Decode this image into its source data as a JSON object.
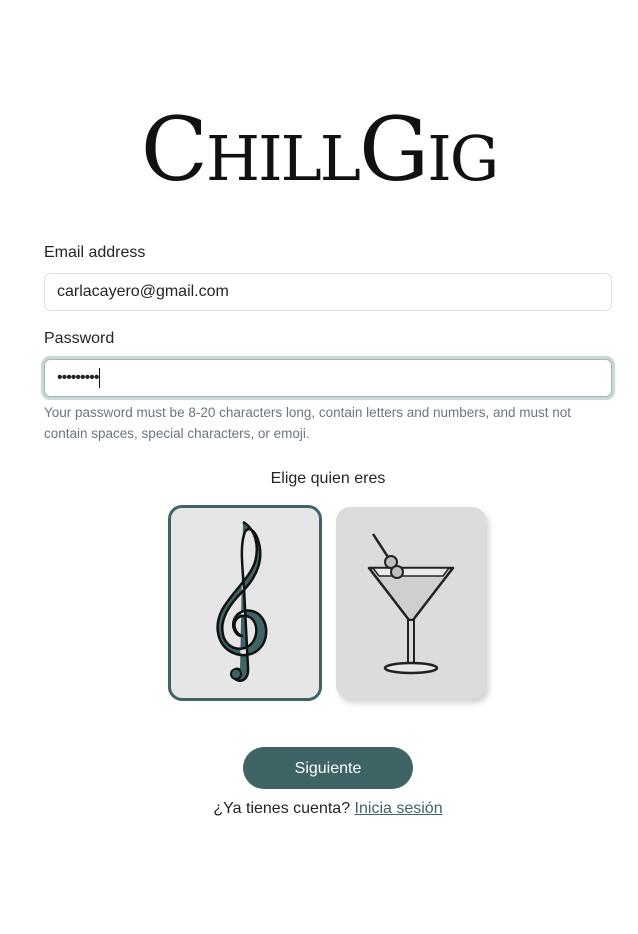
{
  "brand": {
    "logo_text": "ChillGig"
  },
  "form": {
    "email_label": "Email address",
    "email_value": "carlacayero@gmail.com",
    "password_label": "Password",
    "password_value": "•••••••••",
    "password_help": "Your password must be 8-20 characters long, contain letters and numbers, and must not contain spaces, special characters, or emoji."
  },
  "role_picker": {
    "title": "Elige quien eres",
    "options": [
      {
        "icon": "treble-clef-icon",
        "selected": true
      },
      {
        "icon": "martini-glass-icon",
        "selected": false
      }
    ]
  },
  "actions": {
    "next_label": "Siguiente",
    "login_prompt": "¿Ya tienes cuenta?",
    "login_link": "Inicia sesión"
  },
  "colors": {
    "accent": "#3e6466",
    "focus_ring": "#c9d9d8",
    "help_text": "#6c757d"
  }
}
